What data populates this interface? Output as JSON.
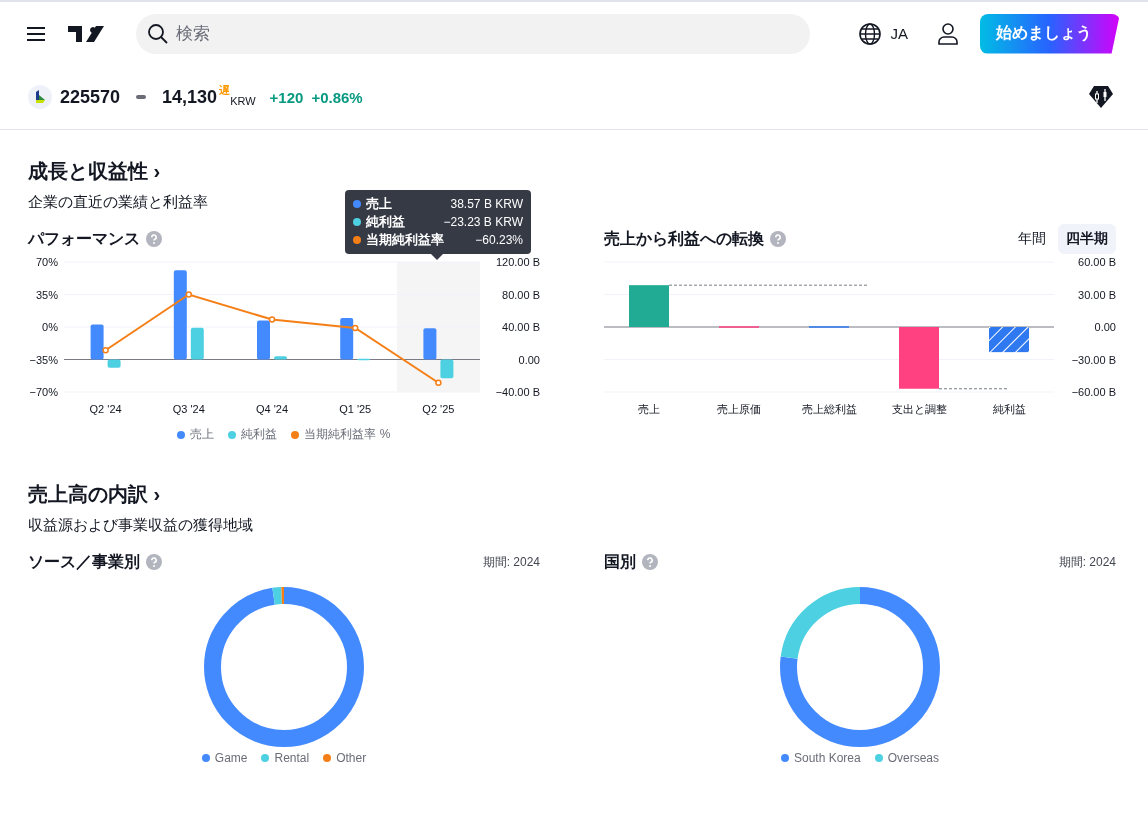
{
  "header": {
    "search": {
      "placeholder": "検索"
    },
    "language": "JA",
    "cta": "始めましょう"
  },
  "ticker": {
    "symbol": "225570",
    "price": "14,130",
    "delayed": "遅",
    "currency": "KRW",
    "change": "+120",
    "change_percent": "+0.86%"
  },
  "growth": {
    "title": "成長と収益性 ›",
    "subtitle": "企業の直近の業績と利益率",
    "performance": {
      "title": "パフォーマンス",
      "tooltip": [
        {
          "label": "売上",
          "value": "38.57 B KRW",
          "color": "#448aff"
        },
        {
          "label": "純利益",
          "value": "−23.23 B KRW",
          "color": "#4dd0e1"
        },
        {
          "label": "当期純利益率",
          "value": "−60.23%",
          "color": "#f57f17"
        }
      ],
      "chart_data": {
        "type": "bar",
        "categories": [
          "Q2 '24",
          "Q3 '24",
          "Q4 '24",
          "Q1 '25",
          "Q2 '25"
        ],
        "series": [
          {
            "name": "売上",
            "color": "#448aff",
            "values": [
              43,
              110,
              48,
              51,
              38.6
            ]
          },
          {
            "name": "純利益",
            "color": "#4dd0e1",
            "values": [
              -10,
              39,
              4,
              1,
              -23.2
            ]
          }
        ],
        "ylim": [
          -40,
          120
        ],
        "yticks": [
          {
            "value": 120,
            "label": "120.00 B"
          },
          {
            "value": 80,
            "label": "80.00 B"
          },
          {
            "value": 40,
            "label": "40.00 B"
          },
          {
            "value": 0,
            "label": "0.00"
          },
          {
            "value": -40,
            "label": "−40.00 B"
          }
        ]
      },
      "margin": {
        "chart_data": {
          "type": "line",
          "series": [
            {
              "name": "当期純利益率 %",
              "color": "#f57f17",
              "marker": true,
              "values": [
                -25,
                35,
                8,
                -1,
                -60
              ]
            }
          ],
          "ylim": [
            -70,
            70
          ],
          "yticks": [
            {
              "value": 70,
              "label": "70%"
            },
            {
              "value": 35,
              "label": "35%"
            },
            {
              "value": 0,
              "label": "0%"
            },
            {
              "value": -35,
              "label": "−35%"
            },
            {
              "value": -70,
              "label": "−70%"
            }
          ]
        }
      }
    },
    "conversion": {
      "title": "売上から利益への転換",
      "periods": [
        {
          "label": "年間",
          "selected": false
        },
        {
          "label": "四半期",
          "selected": true
        }
      ],
      "chart_data": {
        "type": "bar",
        "categories": [
          "売上",
          "売上原価",
          "売上総利益",
          "支出と調整",
          "純利益"
        ],
        "series": [
          {
            "color": "#22ab94",
            "values": [
              38.6,
              null,
              null,
              null,
              null
            ]
          },
          {
            "color": "#ff4081",
            "values": [
              null,
              0,
              null,
              -57,
              null
            ]
          },
          {
            "color": "#2e79f0",
            "values": [
              null,
              null,
              0,
              null,
              -23.2
            ]
          }
        ],
        "stacked": true,
        "ylim": [
          -60,
          60
        ],
        "yticks": [
          {
            "value": 60,
            "label": "60.00 B"
          },
          {
            "value": 30,
            "label": "30.00 B"
          },
          {
            "value": 0,
            "label": "0.00"
          },
          {
            "value": -30,
            "label": "−30.00 B"
          },
          {
            "value": -60,
            "label": "−60.00 B"
          }
        ]
      }
    }
  },
  "revenue": {
    "title": "売上高の内訳 ›",
    "subtitle": "収益源および事業収益の獲得地域",
    "panels": [
      {
        "title": "ソース／事業別",
        "period": "期間: 2024",
        "legend": [
          {
            "label": "Game",
            "color": "#448aff"
          },
          {
            "label": "Rental",
            "color": "#4dd0e1"
          },
          {
            "label": "Other",
            "color": "#f57f17"
          }
        ]
      },
      {
        "title": "国別",
        "period": "期間: 2024",
        "legend": [
          {
            "label": "South Korea",
            "color": "#448aff"
          },
          {
            "label": "Overseas",
            "color": "#4dd0e1"
          }
        ]
      }
    ]
  }
}
